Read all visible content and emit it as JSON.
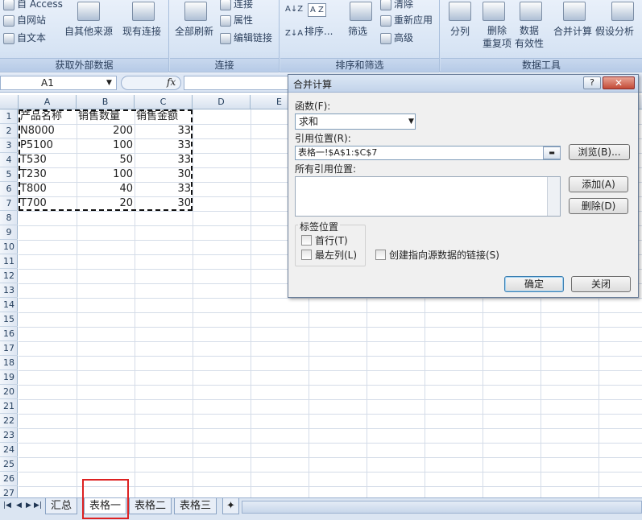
{
  "ribbon": {
    "items": {
      "access": "自 Access",
      "web": "自网站",
      "text": "自文本",
      "other_sources": "自其他来源",
      "existing_conn": "现有连接",
      "refresh_all": "全部刷新",
      "connections": "连接",
      "properties": "属性",
      "edit_links": "编辑链接",
      "sort": "排序...",
      "filter": "筛选",
      "clear": "清除",
      "reapply": "重新应用",
      "advanced": "高级",
      "text_to_columns": "分列",
      "remove_dup_1": "删除",
      "remove_dup_2": "重复项",
      "validation_1": "数据",
      "validation_2": "有效性",
      "consolidate": "合并计算",
      "what_if": "假设分析",
      "sort_az": "A↓Z",
      "sort_za": "Z↓A",
      "sort_az_big": "A Z"
    },
    "groups": {
      "get_external": "获取外部数据",
      "connections": "连接",
      "sort_filter": "排序和筛选",
      "data_tools": "数据工具"
    }
  },
  "formula_bar": {
    "name_box": "A1",
    "fx": "fx",
    "formula": ""
  },
  "sheet": {
    "columns": [
      "A",
      "B",
      "C",
      "D",
      "E"
    ],
    "rows": [
      "1",
      "2",
      "3",
      "4",
      "5",
      "6",
      "7",
      "8",
      "9",
      "10",
      "11",
      "12",
      "13",
      "14",
      "15",
      "16",
      "17",
      "18",
      "19",
      "20",
      "21",
      "22",
      "23",
      "24",
      "25",
      "26",
      "27"
    ],
    "headers": [
      "产品名称",
      "销售数量",
      "销售金额"
    ],
    "data": [
      [
        "N8000",
        "200",
        "33"
      ],
      [
        "P5100",
        "100",
        "33"
      ],
      [
        "T530",
        "50",
        "33"
      ],
      [
        "T230",
        "100",
        "30"
      ],
      [
        "T800",
        "40",
        "33"
      ],
      [
        "T700",
        "20",
        "30"
      ]
    ]
  },
  "tabs": {
    "items": [
      "汇总",
      "表格一",
      "表格二",
      "表格三"
    ],
    "active": "表格一"
  },
  "dialog": {
    "title": "合并计算",
    "help": "?",
    "close": "✕",
    "function_label": "函数(F):",
    "function_value": "求和",
    "reference_label": "引用位置(R):",
    "reference_value": "表格一!$A$1:$C$7",
    "browse": "浏览(B)...",
    "all_refs_label": "所有引用位置:",
    "add": "添加(A)",
    "delete": "删除(D)",
    "label_position": "标签位置",
    "top_row": "首行(T)",
    "left_column": "最左列(L)",
    "create_links": "创建指向源数据的链接(S)",
    "ok": "确定",
    "cancel": "关闭"
  }
}
